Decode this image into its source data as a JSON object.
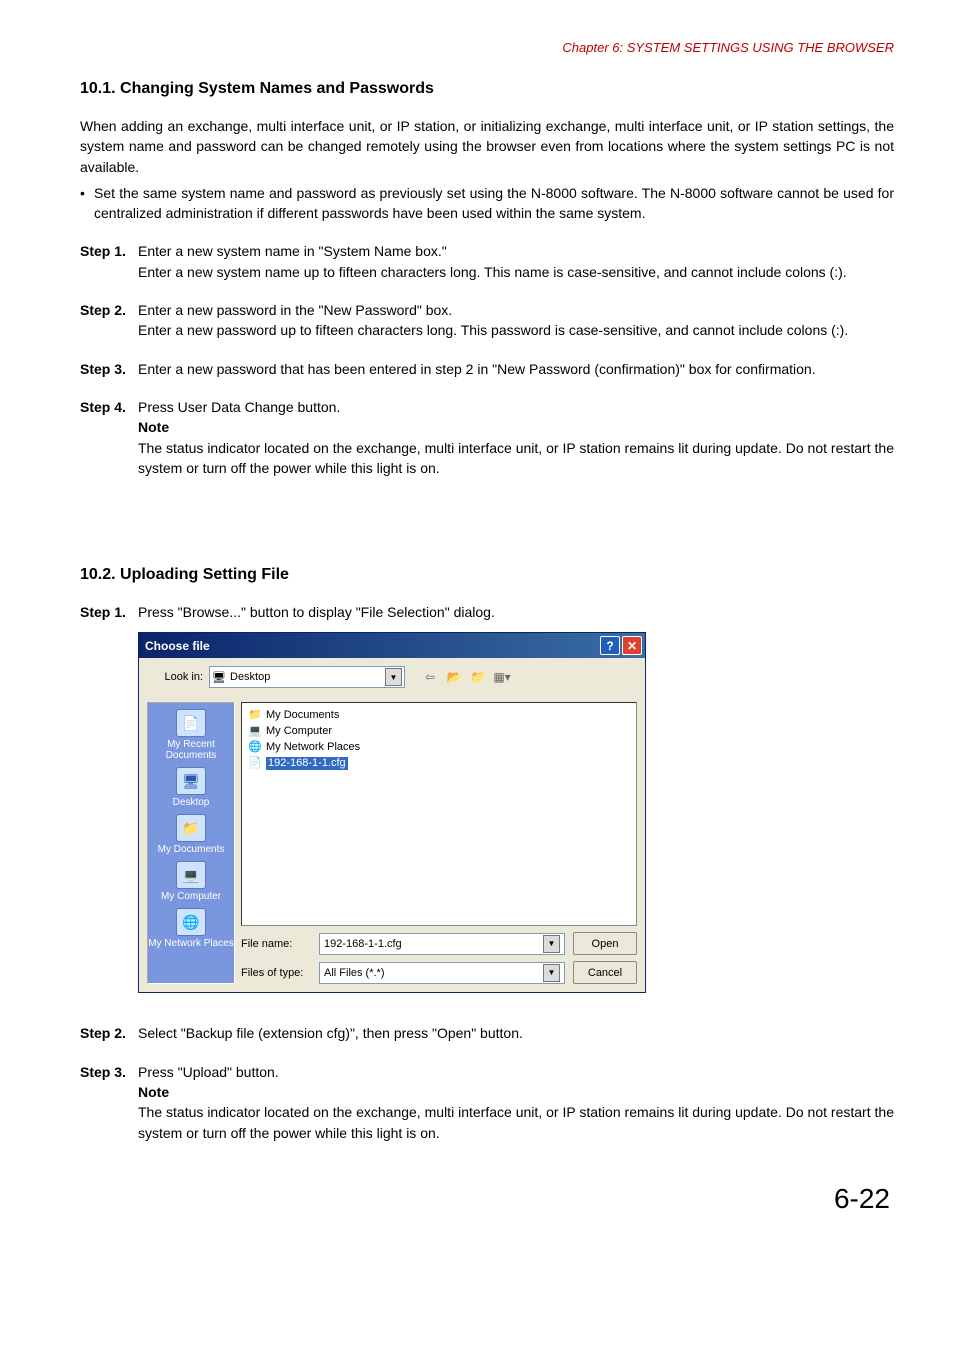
{
  "chapter_header": "Chapter 6:  SYSTEM SETTINGS USING THE BROWSER",
  "section_101_title": "10.1. Changing System Names and Passwords",
  "intro_para": "When adding an exchange, multi interface unit, or IP station, or initializing exchange, multi interface unit, or IP station settings, the system name and password can be changed remotely using the browser even from locations where the system settings PC is not available.",
  "bullet_text": "Set the same system name and password as previously set using the N-8000 software. The N-8000 software cannot be used for centralized administration if different passwords have been used within the same system.",
  "steps_101": [
    {
      "label": "Step 1.",
      "line1": "Enter a new system name in \"System Name box.\"",
      "line2": "Enter a new system name up to fifteen characters long. This name is case-sensitive, and cannot include colons (:)."
    },
    {
      "label": "Step 2.",
      "line1": "Enter a new password in the \"New Password\" box.",
      "line2": "Enter a new password up to fifteen characters long. This password is case-sensitive, and cannot include colons (:)."
    },
    {
      "label": "Step 3.",
      "line1": "Enter a new password that has been entered in step 2 in \"New Password (confirmation)\" box for confirmation."
    },
    {
      "label": "Step 4.",
      "line1": "Press User Data Change button.",
      "note_label": "Note",
      "note_text": "The status indicator located on the exchange, multi interface unit, or IP station remains lit during update. Do not restart the system or turn off the power while this light is on."
    }
  ],
  "section_102_title": "10.2. Uploading Setting File",
  "steps_102": [
    {
      "label": "Step 1.",
      "line1": "Press \"Browse...\" button to display \"File Selection\" dialog."
    },
    {
      "label": "Step 2.",
      "line1": "Select \"Backup file (extension cfg)\", then press \"Open\" button."
    },
    {
      "label": "Step 3.",
      "line1": "Press \"Upload\" button.",
      "note_label": "Note",
      "note_text": "The status indicator located on the exchange, multi interface unit, or IP station remains lit during update. Do not restart the system or turn off the power while this light is on."
    }
  ],
  "dialog": {
    "title": "Choose file",
    "lookin_label": "Look in:",
    "lookin_value": "Desktop",
    "files": [
      {
        "icon": "📁",
        "name": "My Documents",
        "selected": false
      },
      {
        "icon": "💻",
        "name": "My Computer",
        "selected": false
      },
      {
        "icon": "🌐",
        "name": "My Network Places",
        "selected": false
      },
      {
        "icon": "📄",
        "name": "192-168-1-1.cfg",
        "selected": true
      }
    ],
    "places": [
      {
        "icon": "📄",
        "label": "My Recent Documents"
      },
      {
        "icon": "🖥",
        "label": "Desktop"
      },
      {
        "icon": "📁",
        "label": "My Documents"
      },
      {
        "icon": "💻",
        "label": "My Computer"
      },
      {
        "icon": "🌐",
        "label": "My Network Places"
      }
    ],
    "filename_label": "File name:",
    "filename_value": "192-168-1-1.cfg",
    "filetype_label": "Files of type:",
    "filetype_value": "All Files (*.*)",
    "open_label": "Open",
    "cancel_label": "Cancel"
  },
  "page_number": "6-22"
}
